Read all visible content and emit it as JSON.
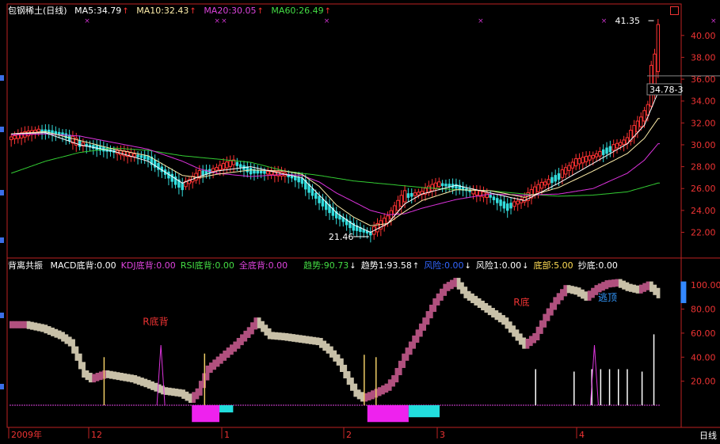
{
  "header": {
    "stock_name": "包钢稀土(日线)",
    "ma5": "MA5:34.79",
    "ma10": "MA10:32.43",
    "ma20": "MA20:30.05",
    "ma60": "MA60:26.49",
    "up_arrow": "↑"
  },
  "indicator_header": {
    "name": "背离共振",
    "items": [
      {
        "label": "MACD底背:0.00",
        "color": "#ffffff",
        "arrow": ""
      },
      {
        "label": "KDJ底背:0.00",
        "color": "#dd44dd",
        "arrow": ""
      },
      {
        "label": "RSI底背:0.00",
        "color": "#44dd44",
        "arrow": ""
      },
      {
        "label": "全底背:0.00",
        "color": "#dd44dd",
        "arrow": ""
      },
      {
        "label": "趋势:90.73",
        "color": "#44dd44",
        "arrow": "↓"
      },
      {
        "label": "趋势1:93.58",
        "color": "#ffffff",
        "arrow": "↑"
      },
      {
        "label": "风险:0.00",
        "color": "#3366ff",
        "arrow": "↓"
      },
      {
        "label": "风险1:0.00",
        "color": "#ffffff",
        "arrow": "↓"
      },
      {
        "label": "底部:5.00",
        "color": "#ffdd55",
        "arrow": ""
      },
      {
        "label": "抄底:0.00",
        "color": "#ffffff",
        "arrow": ""
      }
    ]
  },
  "colors": {
    "up": "#ff3333",
    "down": "#33dddd",
    "ma5": "#ffffff",
    "ma10": "#ffeeaa",
    "ma20": "#dd33dd",
    "ma60": "#33cc33",
    "axis": "#bb2222",
    "trend_up": "#b0507e",
    "trend_down": "#c8c0a8",
    "risk_magenta": "#ee22ee",
    "risk_cyan": "#22dddd"
  },
  "timeframe_button": "日线",
  "chart_data": [
    {
      "type": "candlestick",
      "title": "包钢稀土(日线)",
      "y_ticks": [
        "22.00",
        "24.00",
        "26.00",
        "28.00",
        "30.00",
        "32.00",
        "34.00",
        "36.00",
        "38.00",
        "40.00"
      ],
      "ylim": [
        20.3,
        42.3
      ],
      "annotations": [
        {
          "text": "21.46",
          "bar": 105,
          "value": 21.46
        },
        {
          "text": "41.35",
          "bar": 188,
          "value": 41.35
        },
        {
          "text": "34.78-3",
          "bar": 189,
          "value": 34.78
        }
      ],
      "series_ma60": [
        [
          0,
          27.4
        ],
        [
          10,
          28.5
        ],
        [
          20,
          29.3
        ],
        [
          30,
          29.7
        ],
        [
          40,
          29.5
        ],
        [
          50,
          29.0
        ],
        [
          60,
          28.7
        ],
        [
          70,
          28.4
        ],
        [
          80,
          27.6
        ],
        [
          90,
          27.2
        ],
        [
          100,
          26.7
        ],
        [
          110,
          26.4
        ],
        [
          120,
          26.1
        ],
        [
          130,
          25.9
        ],
        [
          140,
          25.8
        ],
        [
          150,
          25.5
        ],
        [
          160,
          25.3
        ],
        [
          170,
          25.4
        ],
        [
          180,
          25.7
        ],
        [
          189,
          26.5
        ]
      ],
      "series_ma20": [
        [
          0,
          30.9
        ],
        [
          10,
          31.0
        ],
        [
          20,
          30.8
        ],
        [
          30,
          30.2
        ],
        [
          40,
          29.6
        ],
        [
          50,
          28.5
        ],
        [
          55,
          27.8
        ],
        [
          60,
          27.4
        ],
        [
          70,
          27.1
        ],
        [
          80,
          27.3
        ],
        [
          85,
          27.2
        ],
        [
          90,
          26.6
        ],
        [
          95,
          25.6
        ],
        [
          100,
          24.8
        ],
        [
          105,
          24.0
        ],
        [
          110,
          23.6
        ],
        [
          115,
          23.7
        ],
        [
          120,
          24.2
        ],
        [
          130,
          25.0
        ],
        [
          140,
          25.5
        ],
        [
          150,
          25.4
        ],
        [
          160,
          25.5
        ],
        [
          170,
          26.0
        ],
        [
          180,
          27.4
        ],
        [
          185,
          28.6
        ],
        [
          189,
          30.1
        ]
      ],
      "series_ma10": [
        [
          0,
          31.0
        ],
        [
          10,
          31.2
        ],
        [
          20,
          30.4
        ],
        [
          30,
          29.6
        ],
        [
          40,
          29.0
        ],
        [
          50,
          27.2
        ],
        [
          55,
          27.0
        ],
        [
          60,
          27.3
        ],
        [
          70,
          27.7
        ],
        [
          80,
          27.6
        ],
        [
          85,
          27.3
        ],
        [
          90,
          26.2
        ],
        [
          95,
          24.5
        ],
        [
          100,
          23.4
        ],
        [
          105,
          22.6
        ],
        [
          110,
          22.8
        ],
        [
          115,
          23.9
        ],
        [
          120,
          24.9
        ],
        [
          130,
          25.9
        ],
        [
          140,
          25.8
        ],
        [
          150,
          25.2
        ],
        [
          160,
          26.1
        ],
        [
          170,
          27.6
        ],
        [
          180,
          29.2
        ],
        [
          185,
          30.6
        ],
        [
          189,
          32.4
        ]
      ],
      "series_ma5": [
        [
          0,
          31.0
        ],
        [
          10,
          31.1
        ],
        [
          20,
          30.0
        ],
        [
          30,
          29.4
        ],
        [
          40,
          28.5
        ],
        [
          50,
          26.5
        ],
        [
          55,
          27.1
        ],
        [
          60,
          27.6
        ],
        [
          70,
          28.0
        ],
        [
          80,
          27.3
        ],
        [
          85,
          27.0
        ],
        [
          90,
          25.4
        ],
        [
          95,
          23.8
        ],
        [
          100,
          22.7
        ],
        [
          105,
          22.0
        ],
        [
          110,
          22.8
        ],
        [
          115,
          24.6
        ],
        [
          120,
          25.5
        ],
        [
          130,
          26.3
        ],
        [
          140,
          25.6
        ],
        [
          150,
          24.9
        ],
        [
          160,
          26.5
        ],
        [
          170,
          28.3
        ],
        [
          180,
          30.1
        ],
        [
          185,
          31.8
        ],
        [
          189,
          34.8
        ]
      ],
      "candle_path": [
        [
          0,
          30.6
        ],
        [
          8,
          31.3
        ],
        [
          15,
          31.0
        ],
        [
          20,
          30.1
        ],
        [
          30,
          29.4
        ],
        [
          40,
          28.8
        ],
        [
          50,
          26.2
        ],
        [
          55,
          27.3
        ],
        [
          60,
          27.8
        ],
        [
          65,
          28.4
        ],
        [
          70,
          27.6
        ],
        [
          80,
          27.3
        ],
        [
          85,
          26.7
        ],
        [
          90,
          25.0
        ],
        [
          95,
          23.6
        ],
        [
          100,
          22.5
        ],
        [
          105,
          21.9
        ],
        [
          110,
          23.2
        ],
        [
          115,
          25.3
        ],
        [
          120,
          25.6
        ],
        [
          125,
          26.4
        ],
        [
          130,
          26.2
        ],
        [
          135,
          25.7
        ],
        [
          140,
          25.3
        ],
        [
          145,
          24.3
        ],
        [
          150,
          25.0
        ],
        [
          155,
          26.3
        ],
        [
          160,
          27.1
        ],
        [
          165,
          28.4
        ],
        [
          170,
          28.9
        ],
        [
          175,
          29.6
        ],
        [
          180,
          30.4
        ],
        [
          184,
          32.1
        ],
        [
          186,
          33.2
        ],
        [
          187,
          35.4
        ],
        [
          188,
          38.3
        ],
        [
          189,
          39.6
        ]
      ]
    },
    {
      "type": "histogram",
      "title": "背离共振",
      "y_ticks": [
        "20.00",
        "40.00",
        "60.00",
        "80.00",
        "100.00"
      ],
      "ylim": [
        0,
        110
      ],
      "annotations": [
        {
          "text": "R底背",
          "x_rel": 0.205,
          "value": 67
        },
        {
          "text": "R底",
          "x_rel": 0.775,
          "value": 83
        },
        {
          "text": "逃顶",
          "x_rel": 0.905,
          "value": 87
        }
      ],
      "trend_path": [
        [
          0,
          67
        ],
        [
          5,
          67
        ],
        [
          10,
          64
        ],
        [
          15,
          58
        ],
        [
          18,
          52
        ],
        [
          20,
          40
        ],
        [
          22,
          26
        ],
        [
          24,
          22
        ],
        [
          28,
          26
        ],
        [
          32,
          24
        ],
        [
          36,
          22
        ],
        [
          40,
          18
        ],
        [
          45,
          12
        ],
        [
          50,
          10
        ],
        [
          53,
          5
        ],
        [
          55,
          11
        ],
        [
          58,
          30
        ],
        [
          62,
          40
        ],
        [
          66,
          50
        ],
        [
          70,
          62
        ],
        [
          72,
          70
        ],
        [
          74,
          64
        ],
        [
          76,
          58
        ],
        [
          80,
          57
        ],
        [
          85,
          55
        ],
        [
          90,
          53
        ],
        [
          93,
          46
        ],
        [
          96,
          36
        ],
        [
          99,
          20
        ],
        [
          101,
          10
        ],
        [
          103,
          6
        ],
        [
          105,
          8
        ],
        [
          108,
          12
        ],
        [
          110,
          15
        ],
        [
          112,
          22
        ],
        [
          115,
          40
        ],
        [
          118,
          55
        ],
        [
          121,
          70
        ],
        [
          124,
          86
        ],
        [
          127,
          98
        ],
        [
          130,
          103
        ],
        [
          133,
          92
        ],
        [
          136,
          86
        ],
        [
          140,
          78
        ],
        [
          144,
          70
        ],
        [
          147,
          60
        ],
        [
          150,
          50
        ],
        [
          153,
          57
        ],
        [
          156,
          73
        ],
        [
          159,
          87
        ],
        [
          162,
          97
        ],
        [
          165,
          95
        ],
        [
          168,
          90
        ],
        [
          171,
          97
        ],
        [
          174,
          101
        ],
        [
          177,
          102
        ],
        [
          180,
          98
        ],
        [
          183,
          96
        ],
        [
          186,
          100
        ],
        [
          189,
          92
        ]
      ],
      "bars_tall": [
        {
          "bar": 32,
          "value": 40,
          "color": "#eecc66"
        },
        {
          "bar": 66,
          "value": 43,
          "color": "#eecc66"
        },
        {
          "bar": 120,
          "value": 42,
          "color": "#eecc66"
        },
        {
          "bar": 124,
          "value": 40,
          "color": "#eecc66"
        },
        {
          "bar": 178,
          "value": 30,
          "color": "#ffffff"
        },
        {
          "bar": 191,
          "value": 28,
          "color": "#ffffff"
        },
        {
          "bar": 197,
          "value": 30,
          "color": "#ffffff"
        },
        {
          "bar": 200,
          "value": 30,
          "color": "#ffffff"
        },
        {
          "bar": 203,
          "value": 30,
          "color": "#ffffff"
        },
        {
          "bar": 206,
          "value": 30,
          "color": "#ffffff"
        },
        {
          "bar": 209,
          "value": 30,
          "color": "#ffffff"
        },
        {
          "bar": 214,
          "value": 28,
          "color": "#ffffff"
        },
        {
          "bar": 218,
          "value": 59,
          "color": "#ffffff"
        }
      ],
      "spikes": [
        {
          "bar": 44,
          "value": 50
        },
        {
          "bar": 170,
          "value": 50
        }
      ],
      "risk_blocks": [
        {
          "from": 53,
          "to": 61,
          "value": -14,
          "color": "#ee22ee"
        },
        {
          "from": 61,
          "to": 65,
          "value": -6,
          "color": "#22dddd"
        },
        {
          "from": 104,
          "to": 116,
          "value": -14,
          "color": "#ee22ee"
        },
        {
          "from": 116,
          "to": 125,
          "value": -10,
          "color": "#22dddd"
        }
      ],
      "escape_top_bar": {
        "bar": 196,
        "value": 103
      }
    }
  ],
  "x_axis": {
    "labels": [
      {
        "text": "2009年",
        "x": 14
      },
      {
        "text": "12",
        "x": 115
      },
      {
        "text": "1",
        "x": 283
      },
      {
        "text": "2",
        "x": 437
      },
      {
        "text": "3",
        "x": 555
      },
      {
        "text": "4",
        "x": 731
      }
    ]
  }
}
